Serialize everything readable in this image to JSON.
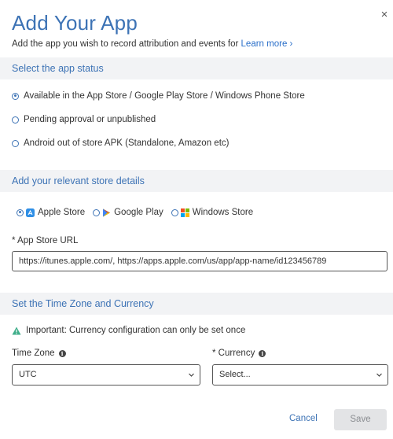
{
  "dialog": {
    "title": "Add Your App",
    "subtitle": "Add the app you wish to record attribution and events for",
    "learn_more": "Learn more ›",
    "close_glyph": "×"
  },
  "status_section": {
    "title": "Select the app status",
    "options": [
      {
        "label": "Available in the App Store / Google Play Store / Windows Phone Store",
        "checked": true
      },
      {
        "label": "Pending approval or unpublished",
        "checked": false
      },
      {
        "label": "Android out of store APK (Standalone, Amazon etc)",
        "checked": false
      }
    ]
  },
  "store_section": {
    "title": "Add your relevant store details",
    "stores": [
      {
        "label": "Apple Store",
        "icon": "apple-store-icon",
        "checked": true
      },
      {
        "label": "Google Play",
        "icon": "google-play-icon",
        "checked": false
      },
      {
        "label": "Windows Store",
        "icon": "windows-store-icon",
        "checked": false
      }
    ],
    "url_label": "* App Store URL",
    "url_value": "https://itunes.apple.com/, https://apps.apple.com/us/app/app-name/id123456789"
  },
  "timezone_section": {
    "title": "Set the Time Zone and Currency",
    "warning": "Important: Currency configuration can only be set once",
    "timezone_label": "Time Zone",
    "timezone_value": "UTC",
    "currency_label": "* Currency",
    "currency_value": "Select..."
  },
  "footer": {
    "cancel_label": "Cancel",
    "save_label": "Save"
  },
  "colors": {
    "accent": "#3d73b5",
    "link": "#2a6fc9",
    "section_bg": "#f2f3f5",
    "warning": "#3fae8a",
    "save_disabled_bg": "#e3e4e6"
  }
}
